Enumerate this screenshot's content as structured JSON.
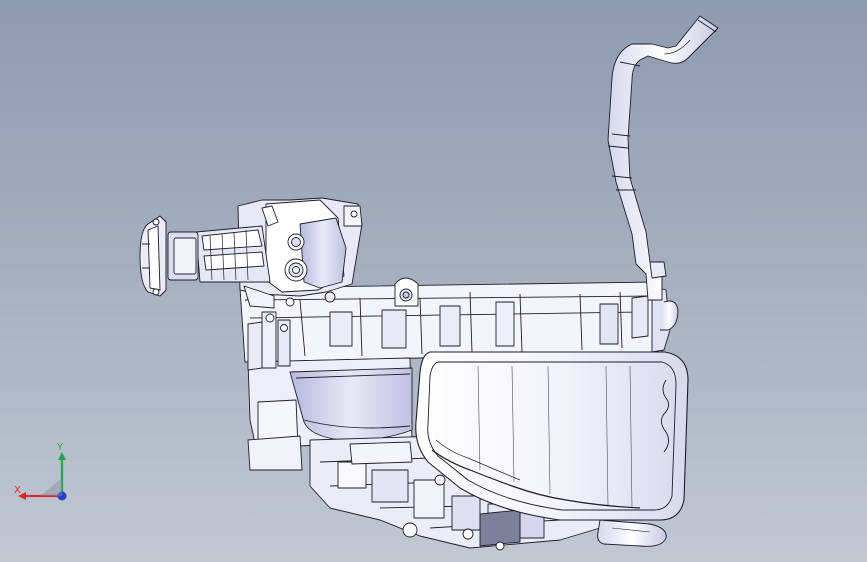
{
  "viewport": {
    "background_top": "#8e9bb0",
    "background_bottom": "#c2c8d3"
  },
  "model": {
    "shade_light": "#ffffff",
    "shade_mid": "#dadbf0",
    "shade_dark": "#a9abd0",
    "edge_color": "#1e1e2a"
  },
  "triad": {
    "x_label": "X",
    "y_label": "Y",
    "x_color": "#d42b2b",
    "y_color": "#1ea84a",
    "z_color": "#2440c8"
  }
}
